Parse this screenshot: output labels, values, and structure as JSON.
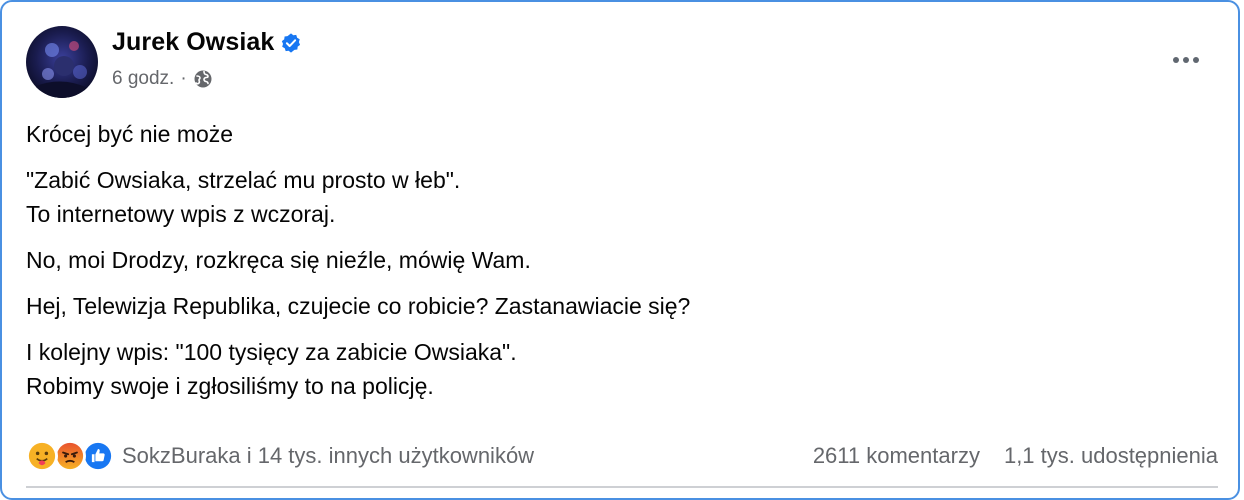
{
  "post": {
    "author": "Jurek Owsiak",
    "time": "6 godz.",
    "separator": "·",
    "visibility_icon": "globe-icon",
    "verified_icon": "verified-badge-icon",
    "more_icon": "more-options-icon",
    "paragraphs": [
      [
        "Krócej być nie może"
      ],
      [
        "\"Zabić Owsiaka, strzelać mu prosto w łeb\".",
        "To internetowy wpis z wczoraj."
      ],
      [
        "No, moi Drodzy, rozkręca się nieźle, mówię Wam."
      ],
      [
        "Hej, Telewizja Republika, czujecie co robicie? Zastanawiacie się?"
      ],
      [
        "I kolejny wpis: \"100 tysięcy za zabicie Owsiaka\".",
        "Robimy swoje i zgłosiliśmy to na policję."
      ]
    ],
    "reactions_text": "SokzBuraka i 14 tys. innych użytkowników",
    "comments": "2611 komentarzy",
    "shares": "1,1 tys. udostępnienia",
    "colors": {
      "accent": "#1877f2",
      "secondary_text": "#65676b",
      "frame_border": "#4a90e2"
    }
  }
}
